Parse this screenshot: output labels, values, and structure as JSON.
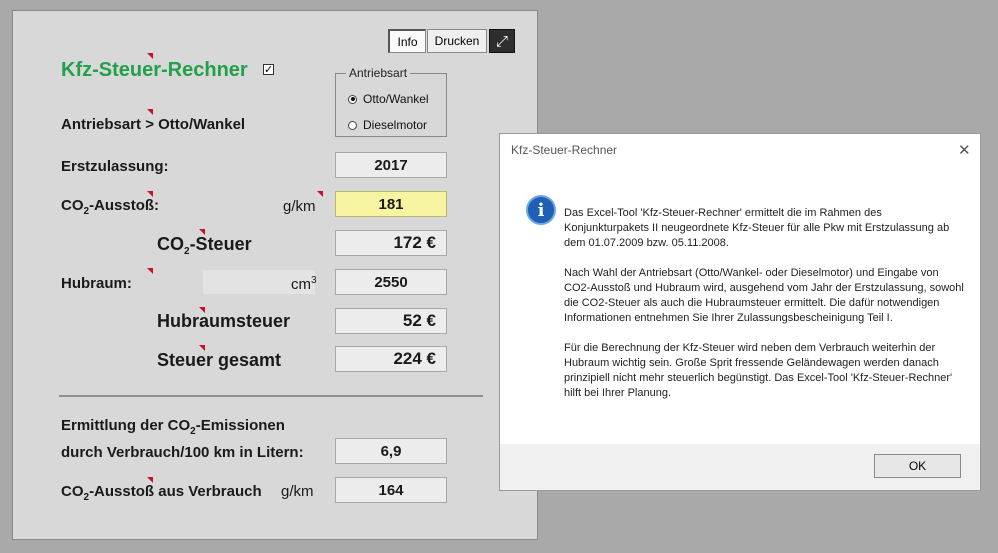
{
  "toolbar": {
    "info_label": "Info",
    "print_label": "Drucken",
    "expand_icon": "⤢"
  },
  "calculator": {
    "title": "Kfz-Steuer-Rechner",
    "checkbox_mark": "✓",
    "drive_group": {
      "legend": "Antriebsart",
      "options": [
        "Otto/Wankel",
        "Dieselmotor"
      ],
      "selected": "Otto/Wankel"
    },
    "antriebsart_label": "Antriebsart",
    "antriebsart_value": "> Otto/Wankel",
    "erstzulassung_label": "Erstzulassung:",
    "erstzulassung_value": "2017",
    "co2_prefix": "CO",
    "co2_sub": "2",
    "co2_ausstoss_suffix": "-Ausstoß:",
    "co2_unit": "g/km",
    "co2_value": "181",
    "co2_steuer_suffix": "-Steuer",
    "co2_steuer_value": "172 €",
    "hubraum_label": "Hubraum:",
    "hubraum_unit": "cm",
    "hubraum_unit_sup": "3",
    "hubraum_value": "2550",
    "hubraumsteuer_label": "Hubraumsteuer",
    "hubraumsteuer_value": "52 €",
    "steuer_gesamt_label": "Steuer gesamt",
    "steuer_gesamt_value": "224 €",
    "emission_heading_prefix": "Ermittlung der CO",
    "emission_heading_sub": "2",
    "emission_heading_suffix": "-Emissionen",
    "verbrauch_label": "durch Verbrauch/100 km in Litern:",
    "verbrauch_value": "6,9",
    "co2_verbrauch_suffix": "-Ausstoß aus Verbrauch",
    "co2_verbrauch_unit": "g/km",
    "co2_verbrauch_value": "164"
  },
  "dialog": {
    "title": "Kfz-Steuer-Rechner",
    "close_icon": "✕",
    "info_glyph": "i",
    "paragraphs": [
      "Das Excel-Tool 'Kfz-Steuer-Rechner' ermittelt die im Rahmen des Konjunkturpakets II neugeordnete Kfz-Steuer für alle Pkw mit Erstzulassung ab dem 01.07.2009 bzw. 05.11.2008.",
      "Nach Wahl der Antriebsart (Otto/Wankel- oder Dieselmotor) und Eingabe von CO2-Ausstoß und Hubraum wird, ausgehend vom Jahr der Erstzulassung, sowohl die CO2-Steuer als auch die Hubraumsteuer ermittelt. Die dafür notwendigen Informationen entnehmen Sie Ihrer Zulassungsbescheinigung Teil I.",
      "Für die Berechnung der Kfz-Steuer wird neben dem Verbrauch weiterhin der Hubraum wichtig sein. Große Sprit fressende Geländewagen werden danach prinzipiell nicht mehr steuerlich begünstigt. Das Excel-Tool 'Kfz-Steuer-Rechner' hilft bei Ihrer Planung."
    ],
    "ok_label": "OK"
  },
  "colors": {
    "title_green": "#22a04a",
    "input_yellow": "#f7f4a2",
    "comment_red": "#c8102e",
    "info_blue": "#1f5fb4"
  }
}
